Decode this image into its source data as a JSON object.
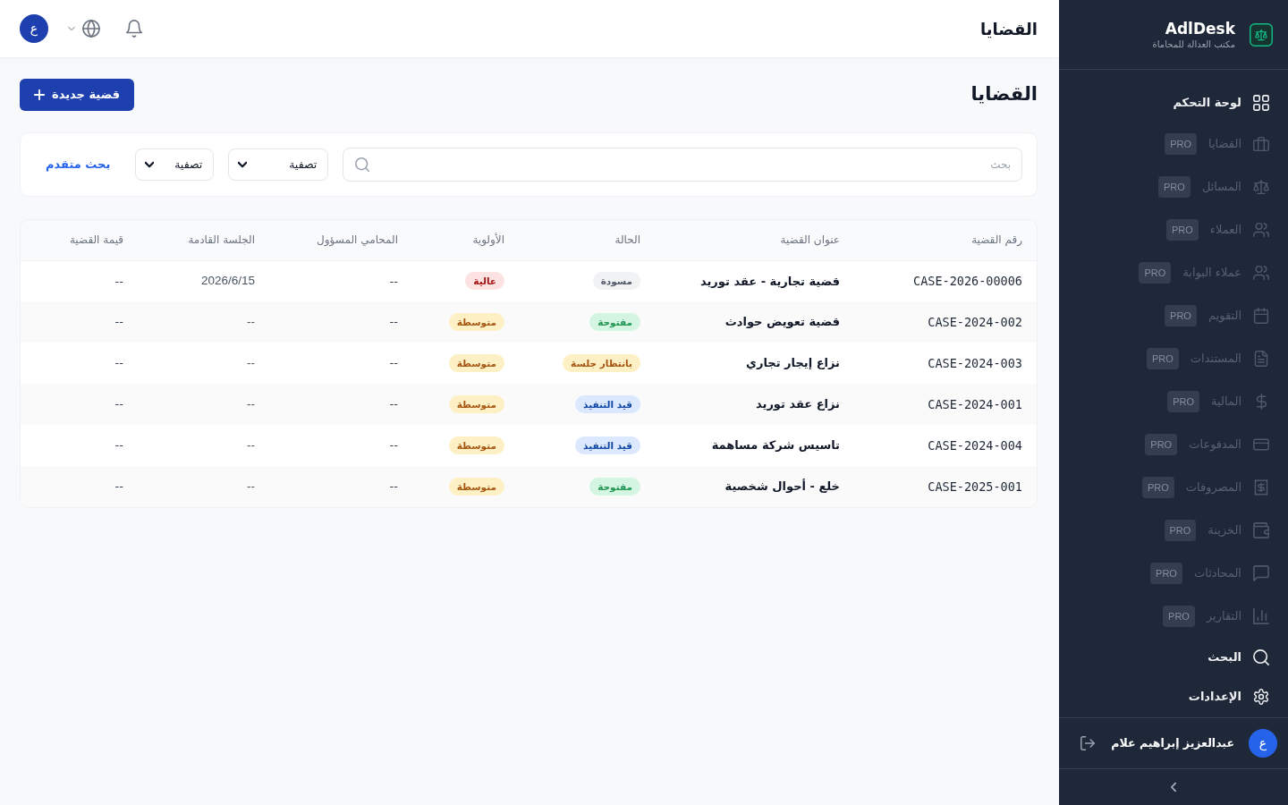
{
  "sidebar": {
    "brand": {
      "name": "AdlDesk",
      "tagline": "مكتب العدالة للمحاماة"
    },
    "items": [
      {
        "label": "لوحة التحكم",
        "disabled": false
      },
      {
        "label": "القضايا",
        "badge": "PRO",
        "disabled": true
      },
      {
        "label": "المسائل",
        "badge": "PRO",
        "disabled": true
      },
      {
        "label": "العملاء",
        "badge": "PRO",
        "disabled": true
      },
      {
        "label": "عملاء البوابة",
        "badge": "PRO",
        "disabled": true
      },
      {
        "label": "التقويم",
        "badge": "PRO",
        "disabled": true
      },
      {
        "label": "المستندات",
        "badge": "PRO",
        "disabled": true
      },
      {
        "label": "المالية",
        "badge": "PRO",
        "disabled": true
      },
      {
        "label": "المدفوعات",
        "badge": "PRO",
        "disabled": true
      },
      {
        "label": "المصروفات",
        "badge": "PRO",
        "disabled": true
      },
      {
        "label": "الخزينة",
        "badge": "PRO",
        "disabled": true
      },
      {
        "label": "المحادثات",
        "badge": "PRO",
        "disabled": true
      },
      {
        "label": "التقارير",
        "badge": "PRO",
        "disabled": true
      },
      {
        "label": "البحث",
        "disabled": false
      },
      {
        "label": "الإعدادات",
        "disabled": false
      }
    ],
    "user": {
      "avatar": "ع",
      "name": "عبدالعزيز إبراهيم علام"
    }
  },
  "header": {
    "title": "القضايا",
    "avatar": "ع"
  },
  "page": {
    "title": "القضايا",
    "new_button": "قضية جديدة"
  },
  "filters": {
    "search": {
      "placeholder": "بحث"
    },
    "dropdowns": [
      "تصفية",
      "تصفية"
    ],
    "advanced_search": "بحث متقدم"
  },
  "table": {
    "columns": [
      "رقم القضية",
      "عنوان القضية",
      "الحالة",
      "الأولوية",
      "المحامي المسؤول",
      "الجلسة القادمة",
      "قيمة القضية"
    ],
    "rows": [
      {
        "case_number": "CASE-2026-00006",
        "title": "قضية تجارية - عقد توريد",
        "status": {
          "label": "مسودة",
          "color": "#f1f2f4"
        },
        "priority": {
          "label": "عالية",
          "color": "#fde2e2"
        },
        "lawyer": "--",
        "next_hearing": "2026/6/15",
        "value": "--"
      },
      {
        "case_number": "CASE-2024-002",
        "title": "قضية تعويض حوادث",
        "status": {
          "label": "مفتوحة",
          "color": "#d4f5e2"
        },
        "priority": {
          "label": "متوسطة",
          "color": "#fdf0c4"
        },
        "lawyer": "--",
        "next_hearing": "--",
        "value": "--"
      },
      {
        "case_number": "CASE-2024-003",
        "title": "نزاع إيجار تجاري",
        "status": {
          "label": "بانتظار جلسة",
          "color": "#fdf0c4"
        },
        "priority": {
          "label": "متوسطة",
          "color": "#fdf0c4"
        },
        "lawyer": "--",
        "next_hearing": "--",
        "value": "--"
      },
      {
        "case_number": "CASE-2024-001",
        "title": "نزاع عقد توريد",
        "status": {
          "label": "قيد التنفيذ",
          "color": "#dbe8fe"
        },
        "priority": {
          "label": "متوسطة",
          "color": "#fdf0c4"
        },
        "lawyer": "--",
        "next_hearing": "--",
        "value": "--"
      },
      {
        "case_number": "CASE-2024-004",
        "title": "تاسيس شركة مساهمة",
        "status": {
          "label": "قيد التنفيذ",
          "color": "#dbe8fe"
        },
        "priority": {
          "label": "متوسطة",
          "color": "#fdf0c4"
        },
        "lawyer": "--",
        "next_hearing": "--",
        "value": "--"
      },
      {
        "case_number": "CASE-2025-001",
        "title": "خلع - أحوال شخصية",
        "status": {
          "label": "مفتوحة",
          "color": "#d4f5e2"
        },
        "priority": {
          "label": "متوسطة",
          "color": "#fdf0c4"
        },
        "lawyer": "--",
        "next_hearing": "--",
        "value": "--"
      }
    ]
  }
}
